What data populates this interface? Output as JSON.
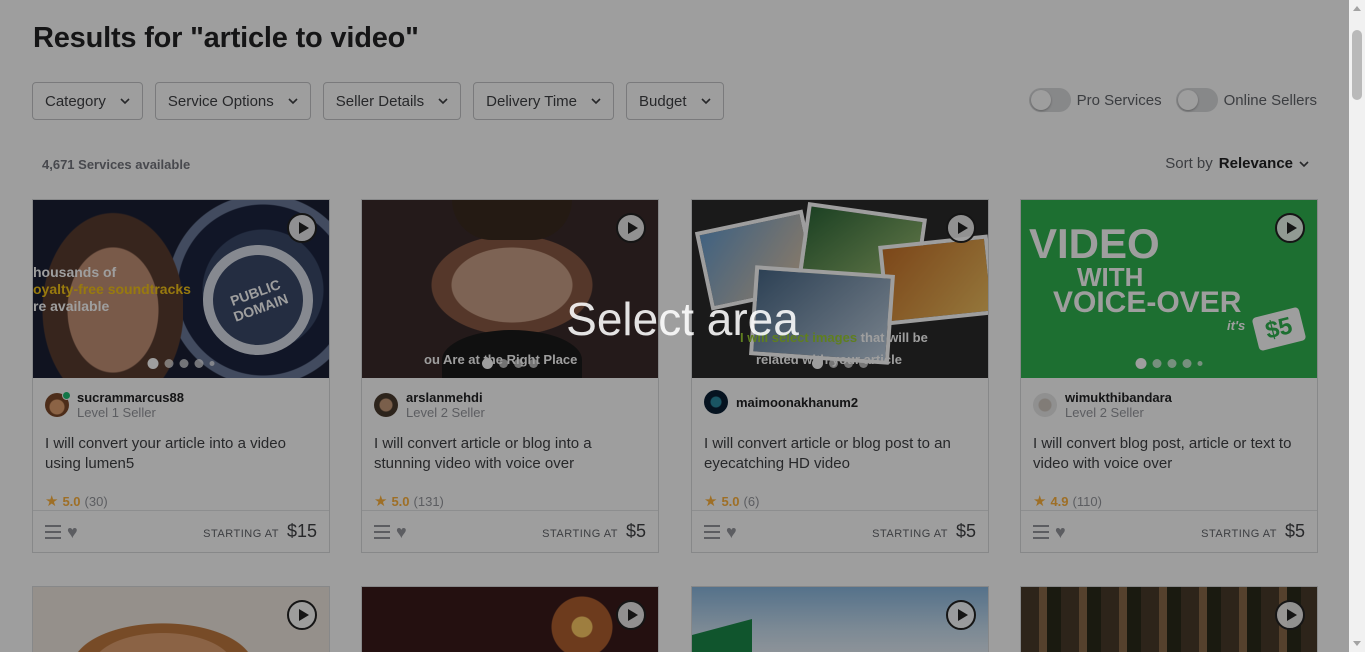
{
  "page": {
    "title": "Results for \"article to video\"",
    "services_count": "4,671 Services available",
    "overlay_text": "Select area"
  },
  "filters": [
    {
      "label": "Category"
    },
    {
      "label": "Service Options"
    },
    {
      "label": "Seller Details"
    },
    {
      "label": "Delivery Time"
    },
    {
      "label": "Budget"
    }
  ],
  "toggles": {
    "pro_services": {
      "label": "Pro Services",
      "on": false
    },
    "online_sellers": {
      "label": "Online Sellers",
      "on": false
    }
  },
  "sort": {
    "label": "Sort by",
    "value": "Relevance"
  },
  "gigs": [
    {
      "seller": "sucrammarcus88",
      "level": "Level 1 Seller",
      "title": "I will convert your article into a video using lumen5",
      "rating": "5.0",
      "reviews": "(30)",
      "starting_label": "STARTING AT",
      "price": "$15",
      "thumb_lines": [
        "housands of",
        "oyalty-free soundtracks",
        "re available"
      ],
      "thumb_badge": "PUBLIC DOMAIN"
    },
    {
      "seller": "arslanmehdi",
      "level": "Level 2 Seller",
      "title": "I will convert article or blog into a stunning video with voice over",
      "rating": "5.0",
      "reviews": "(131)",
      "starting_label": "STARTING AT",
      "price": "$5",
      "thumb_caption": "ou Are at the Right Place"
    },
    {
      "seller": "maimoonakhanum2",
      "level": "",
      "title": "I will convert article or blog post to an eyecatching HD video",
      "rating": "5.0",
      "reviews": "(6)",
      "starting_label": "STARTING AT",
      "price": "$5",
      "thumb_caption_hl": "I will select images",
      "thumb_caption_rest": " that will be",
      "thumb_caption_2": "related with your article"
    },
    {
      "seller": "wimukthibandara",
      "level": "Level 2 Seller",
      "title": "I will convert blog post, article or text to video with voice over",
      "rating": "4.9",
      "reviews": "(110)",
      "starting_label": "STARTING AT",
      "price": "$5",
      "thumb_line1": "VIDEO",
      "thumb_line2": "WITH",
      "thumb_line3": "VOICE-OVER",
      "thumb_its": "it's",
      "thumb_price": "$5"
    }
  ],
  "colors": {
    "accent_green": "#1dbf73",
    "star": "#ffb33e"
  }
}
